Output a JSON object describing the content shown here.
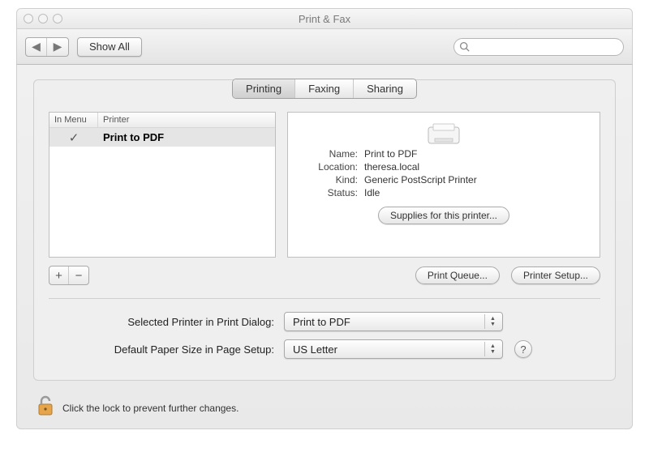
{
  "window": {
    "title": "Print & Fax"
  },
  "toolbar": {
    "back_icon": "◀",
    "forward_icon": "▶",
    "show_all_label": "Show All",
    "search_placeholder": ""
  },
  "tabs": {
    "items": [
      "Printing",
      "Faxing",
      "Sharing"
    ],
    "active_index": 0
  },
  "printer_list": {
    "columns": {
      "in_menu": "In Menu",
      "printer": "Printer"
    },
    "rows": [
      {
        "in_menu": "✓",
        "name": "Print to PDF"
      }
    ]
  },
  "details": {
    "labels": {
      "name": "Name:",
      "location": "Location:",
      "kind": "Kind:",
      "status": "Status:"
    },
    "values": {
      "name": "Print to PDF",
      "location": "theresa.local",
      "kind": "Generic PostScript Printer",
      "status": "Idle"
    },
    "supplies_label": "Supplies for this printer..."
  },
  "buttons": {
    "add": "+",
    "remove": "−",
    "print_queue": "Print Queue...",
    "printer_setup": "Printer Setup..."
  },
  "form": {
    "selected_printer_label": "Selected Printer in Print Dialog:",
    "selected_printer_value": "Print to PDF",
    "paper_size_label": "Default Paper Size in Page Setup:",
    "paper_size_value": "US Letter",
    "help": "?"
  },
  "lock": {
    "text": "Click the lock to prevent further changes."
  }
}
